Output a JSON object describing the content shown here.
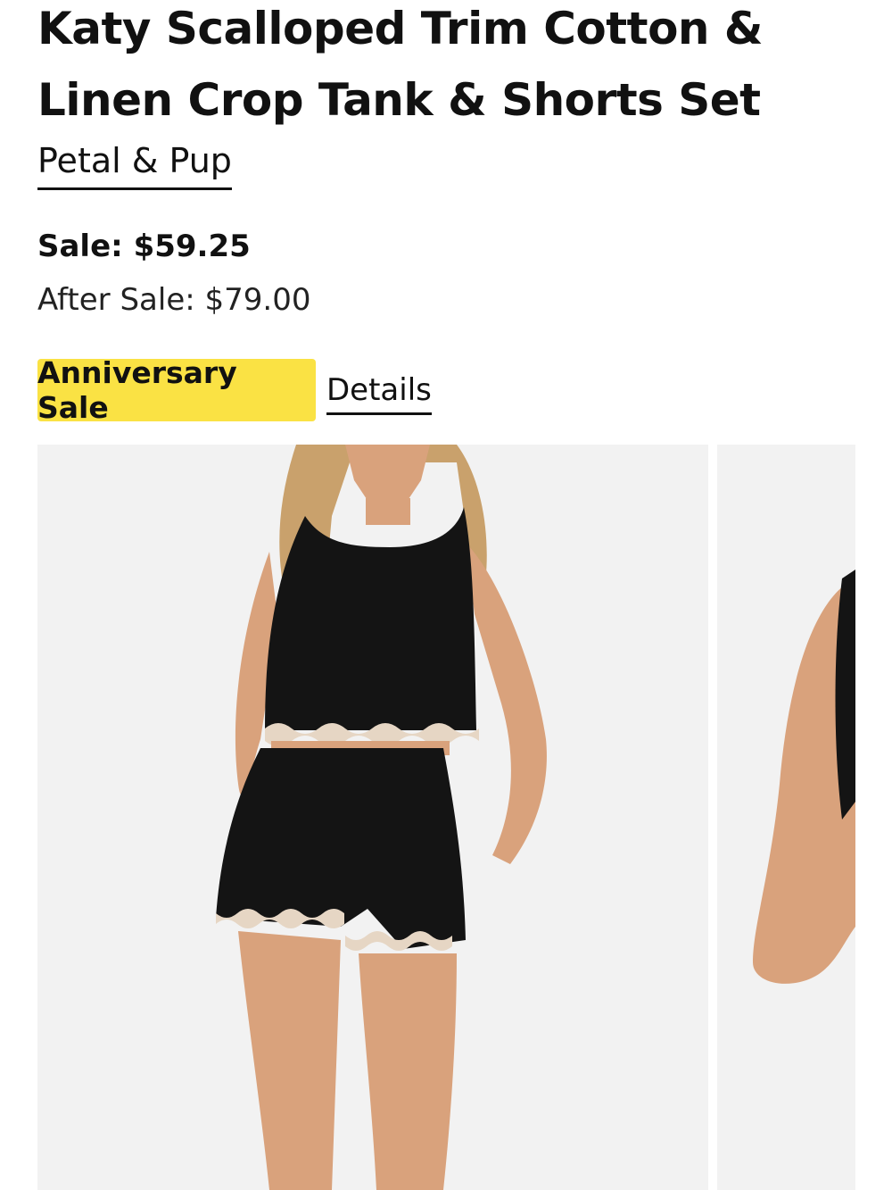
{
  "product": {
    "title": "Katy Scalloped Trim Cotton & Linen Crop Tank & Shorts Set",
    "brand": "Petal & Pup",
    "sale_price": "Sale: $59.25",
    "after_sale_price": "After Sale: $79.00",
    "promo_badge": "Anniversary Sale",
    "details_link": "Details"
  },
  "gallery": {
    "images": [
      {
        "name": "product-photo-front"
      },
      {
        "name": "product-photo-side"
      }
    ]
  },
  "colors": {
    "badge": "#fae244",
    "photo_background": "#f2f2f2",
    "garment": "#141414",
    "trim": "#e6d6c4",
    "skin": "#d9a27c"
  }
}
